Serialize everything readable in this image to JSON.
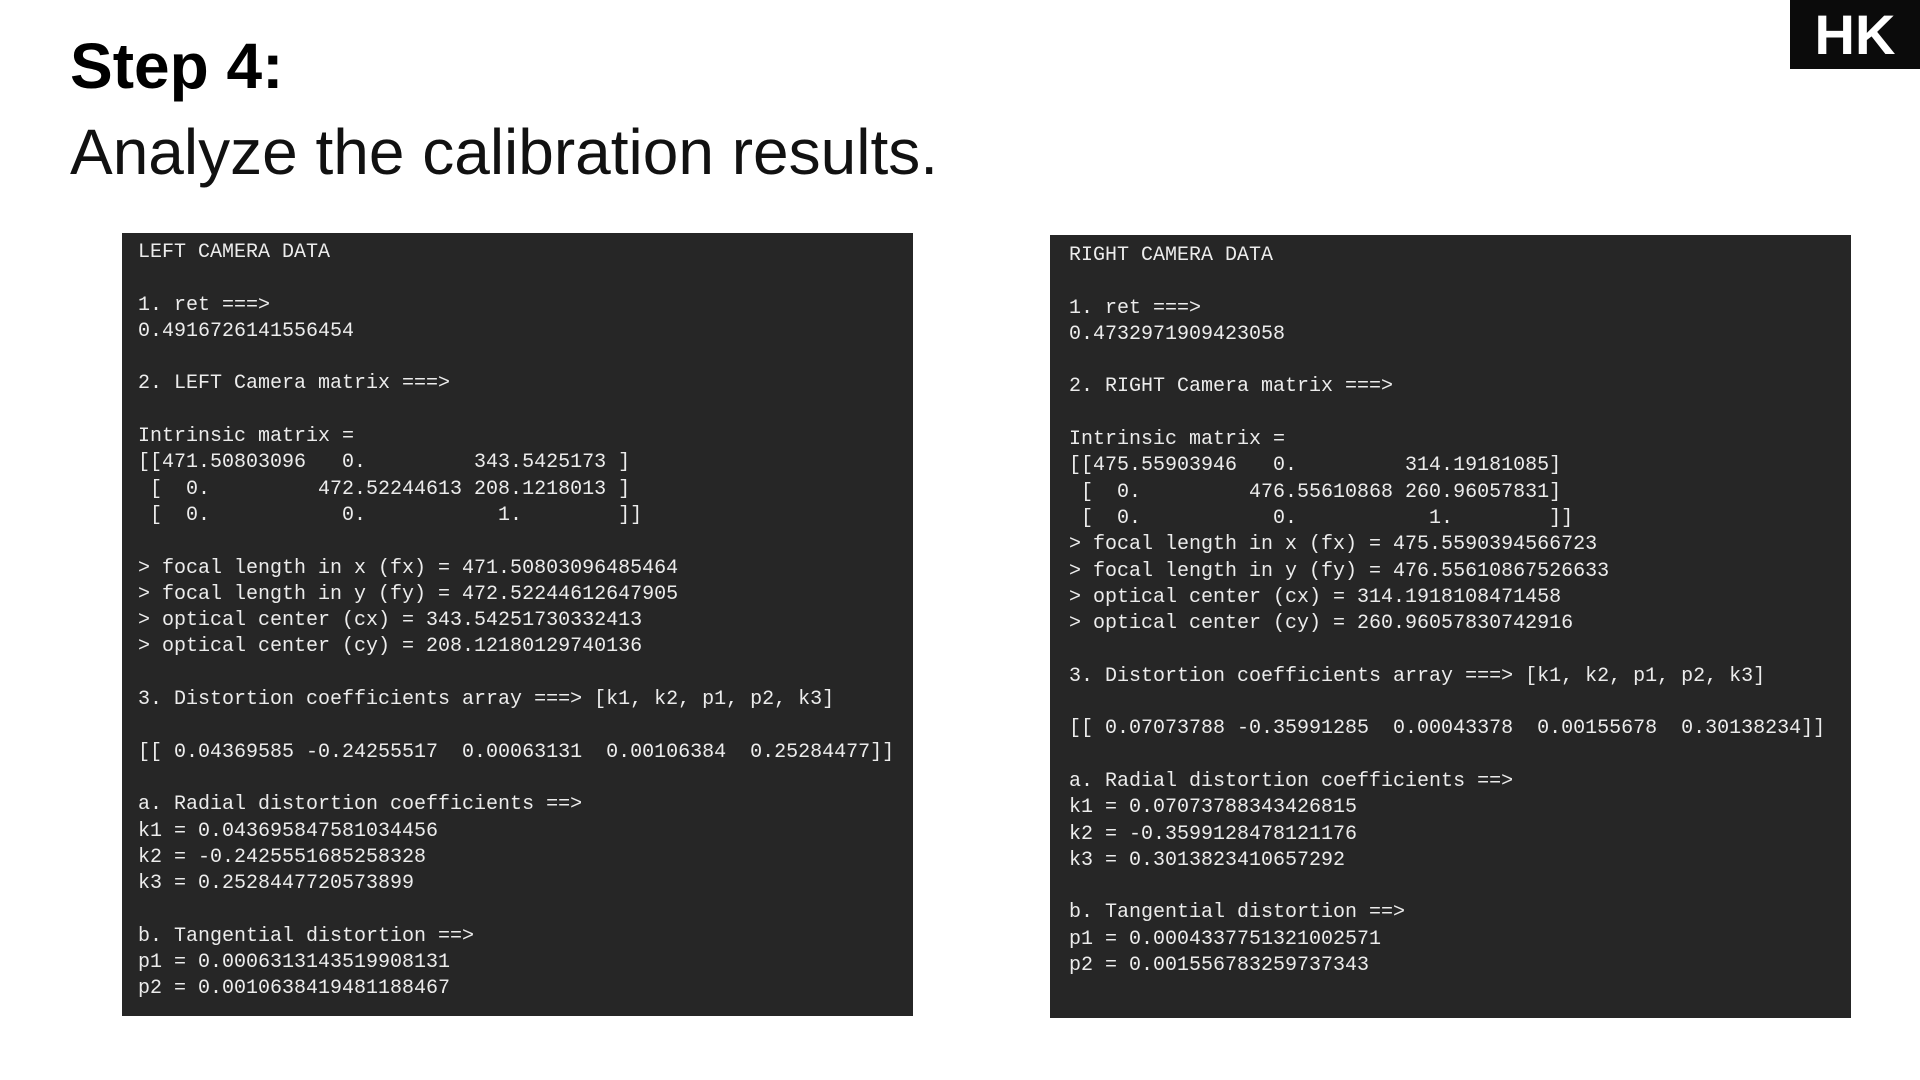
{
  "slide": {
    "title": "Step 4:",
    "subtitle": "Analyze the calibration results."
  },
  "logo": {
    "text": "HK"
  },
  "left_panel": {
    "lines": [
      "LEFT CAMERA DATA",
      "",
      "1. ret ===>",
      "0.4916726141556454",
      "",
      "2. LEFT Camera matrix ===>",
      "",
      "Intrinsic matrix =",
      "[[471.50803096   0.         343.5425173 ]",
      " [  0.         472.52244613 208.1218013 ]",
      " [  0.           0.           1.        ]]",
      "",
      "> focal length in x (fx) = 471.50803096485464",
      "> focal length in y (fy) = 472.52244612647905",
      "> optical center (cx) = 343.54251730332413",
      "> optical center (cy) = 208.12180129740136",
      "",
      "3. Distortion coefficients array ===> [k1, k2, p1, p2, k3]",
      "",
      "[[ 0.04369585 -0.24255517  0.00063131  0.00106384  0.25284477]]",
      "",
      "a. Radial distortion coefficients ==>",
      "k1 = 0.043695847581034456",
      "k2 = -0.2425551685258328",
      "k3 = 0.2528447720573899",
      "",
      "b. Tangential distortion ==>",
      "p1 = 0.0006313143519908131",
      "p2 = 0.0010638419481188467"
    ]
  },
  "right_panel": {
    "lines": [
      "RIGHT CAMERA DATA",
      "",
      "1. ret ===>",
      "0.4732971909423058",
      "",
      "2. RIGHT Camera matrix ===>",
      "",
      "Intrinsic matrix =",
      "[[475.55903946   0.         314.19181085]",
      " [  0.         476.55610868 260.96057831]",
      " [  0.           0.           1.        ]]",
      "> focal length in x (fx) = 475.5590394566723",
      "> focal length in y (fy) = 476.55610867526633",
      "> optical center (cx) = 314.1918108471458",
      "> optical center (cy) = 260.96057830742916",
      "",
      "3. Distortion coefficients array ===> [k1, k2, p1, p2, k3]",
      "",
      "[[ 0.07073788 -0.35991285  0.00043378  0.00155678  0.30138234]]",
      "",
      "a. Radial distortion coefficients ==>",
      "k1 = 0.07073788343426815",
      "k2 = -0.3599128478121176",
      "k3 = 0.3013823410657292",
      "",
      "b. Tangential distortion ==>",
      "p1 = 0.0004337751321002571",
      "p2 = 0.001556783259737343"
    ]
  }
}
